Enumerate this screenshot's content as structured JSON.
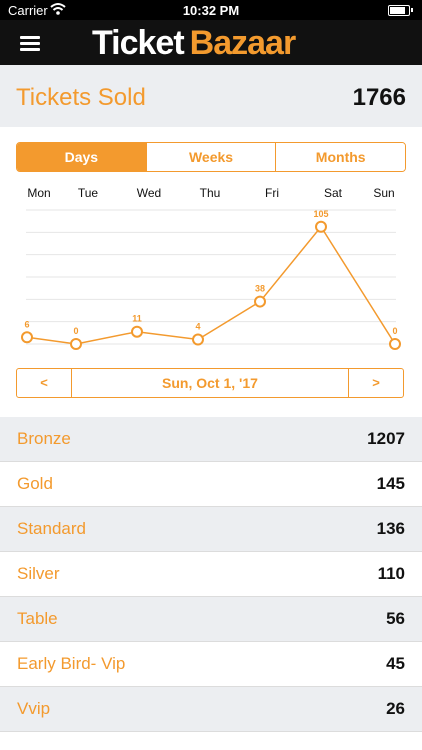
{
  "status": {
    "carrier": "Carrier",
    "time": "10:32 PM"
  },
  "header": {
    "logo_word1": "Ticket",
    "logo_word2": "Bazaar"
  },
  "summary": {
    "label": "Tickets Sold",
    "value": "1766"
  },
  "tabs": [
    {
      "label": "Days",
      "active": true
    },
    {
      "label": "Weeks",
      "active": false
    },
    {
      "label": "Months",
      "active": false
    }
  ],
  "chart_data": {
    "type": "line",
    "categories": [
      "Mon",
      "Tue",
      "Wed",
      "Thu",
      "Fri",
      "Sat",
      "Sun"
    ],
    "values": [
      6,
      0,
      11,
      4,
      38,
      105,
      0
    ],
    "title": "",
    "xlabel": "",
    "ylabel": "",
    "ylim": [
      0,
      120
    ],
    "grid": true,
    "color": "#f39a2e"
  },
  "date_nav": {
    "prev": "<",
    "date": "Sun, Oct 1, '17",
    "next": ">"
  },
  "ticket_types": [
    {
      "name": "Bronze",
      "count": "1207"
    },
    {
      "name": "Gold",
      "count": "145"
    },
    {
      "name": "Standard",
      "count": "136"
    },
    {
      "name": "Silver",
      "count": "110"
    },
    {
      "name": "Table",
      "count": "56"
    },
    {
      "name": "Early Bird- Vip",
      "count": "45"
    },
    {
      "name": "Vvip",
      "count": "26"
    }
  ],
  "colors": {
    "accent": "#f39a2e",
    "header_bg": "#111111",
    "stripe": "#eceef1"
  }
}
